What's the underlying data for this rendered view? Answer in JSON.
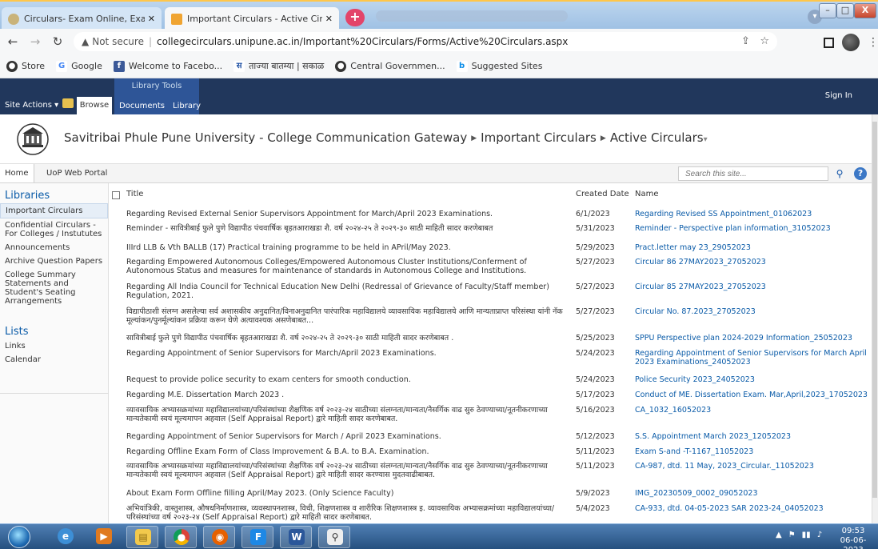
{
  "browser": {
    "tabs": [
      {
        "title": "Circulars- Exam Online, Examinat",
        "active": false
      },
      {
        "title": "Important Circulars - Active Circu",
        "active": true
      }
    ],
    "new_tab": "+",
    "window_controls": {
      "minimize": "–",
      "maximize": "□",
      "close": "X"
    },
    "url_warning": "Not secure",
    "url": "collegecirculars.unipune.ac.in/Important%20Circulars/Forms/Active%20Circulars.aspx",
    "bookmarks": [
      {
        "label": "Store",
        "icon": "chrome-web-store-icon"
      },
      {
        "label": "Google",
        "icon": "google-icon"
      },
      {
        "label": "Welcome to Facebo...",
        "icon": "facebook-icon"
      },
      {
        "label": "ताज्या बातम्या | सकाळ",
        "icon": "sakal-icon"
      },
      {
        "label": "Central Governmen...",
        "icon": "globe-icon"
      },
      {
        "label": "Suggested Sites",
        "icon": "bing-icon"
      }
    ]
  },
  "ribbon": {
    "site_actions": "Site Actions ▾",
    "browse": "Browse",
    "context_label": "Library Tools",
    "context_tabs": [
      "Documents",
      "Library"
    ],
    "sign_in": "Sign In"
  },
  "header": {
    "site_name": "Savitribai Phule Pune University - College Communication Gateway",
    "crumb_1": "Important Circulars",
    "crumb_2": "Active Circulars",
    "crumb_2_suffix": "▾"
  },
  "toplinks": {
    "home": "Home",
    "portal": "UoP Web Portal",
    "search_placeholder": "Search this site..."
  },
  "leftnav": {
    "libraries_heading": "Libraries",
    "libraries": [
      "Important Circulars",
      "Confidential Circulars - For Colleges / Instututes",
      "Announcements",
      "Archive Question Papers",
      "College Summary Statements and Student's Seating Arrangements"
    ],
    "lists_heading": "Lists",
    "lists": [
      "Links",
      "Calendar"
    ]
  },
  "list": {
    "columns": {
      "title": "Title",
      "created": "Created Date",
      "name": "Name"
    },
    "rows": [
      {
        "title": "Regarding Revised External Senior Supervisors Appointment for March/April 2023 Examinations.",
        "created": "6/1/2023",
        "name": "Regarding Revised SS Appointment_01062023"
      },
      {
        "title": "Reminder - सावित्रीबाई फुले पुणे विद्यापीठ पंचवार्षिक बृहतआराखडा शै. वर्ष २०२४-२५ ते २०२९-३० साठी माहिती सादर करणेबाबत",
        "created": "5/31/2023",
        "name": "Reminder - Perspective plan information_31052023"
      },
      {
        "title": "IIIrd LLB & Vth BALLB (17) Practical training programme to be held in APril/May 2023.",
        "created": "5/29/2023",
        "name": "Pract.letter may 23_29052023"
      },
      {
        "title": " Regarding Empowered Autonomous Colleges/Empowered Autonomous Cluster Institutions/Conferment of Autonomous Status and measures for maintenance of standards in Autonomous College and Institutions.",
        "created": "5/27/2023",
        "name": "Circular 86 27MAY2023_27052023"
      },
      {
        "title": "Regarding All India Council for Technical Education New Delhi (Redressal of Grievance of Faculty/Staff member) Regulation, 2021.",
        "created": "5/27/2023",
        "name": "Circular 85 27MAY2023_27052023"
      },
      {
        "title": "विद्यापीठाशी संलग्न असलेल्या सर्व अशासकीय अनुदानित/विनाअनुदानित पारंपारिक महाविद्यालये व्यावसायिक महाविद्यालये आणि मान्यताप्राप्त परिसंस्था यांनी नॅक मूल्यांकन/पुनर्मूल्यांकन प्रक्रिया करून घेणे अत्यावश्यक असणेबाबत...",
        "created": "5/27/2023",
        "name": "Circular No. 87.2023_27052023"
      },
      {
        "title": "सावित्रीबाई फुले पुणे विद्यापीठ पंचवार्षिक बृहतआराखडा शै. वर्ष २०२४-२५ ते २०२९-३० साठी माहिती सादर करणेबाबत .",
        "created": "5/25/2023",
        "name": "SPPU Perspective plan 2024-2029 Information_25052023"
      },
      {
        "title": "Regarding  Appointment of Senior Supervisors for March/April 2023  Examinations.",
        "created": "5/24/2023",
        "name": "Regarding Appointment of Senior Supervisors for March April 2023 Examinations_24052023"
      },
      {
        "title": "Request to provide police security to exam centers for smooth conduction.",
        "created": "5/24/2023",
        "name": "Police Security 2023_24052023"
      },
      {
        "title": "Regarding M.E. Dissertation March 2023 .",
        "created": "5/17/2023",
        "name": "Conduct of ME. Dissertation Exam. Mar,April,2023_17052023"
      },
      {
        "title": "व्यावसायिक अभ्यासक्रमांच्या महाविद्यालयांच्या/परिसंस्थांच्या शैक्षणिक वर्ष २०२३-२४ साठीच्या संलग्नता/मान्यता/नैसर्गिक वाढ सुरु ठेवण्याच्या/नूतनीकरणाच्या मान्यतेकामी स्वयं मूल्यमापन अहवाल (Self Appraisal Report) द्वारे माहिती सादर करणेबाबत.",
        "created": "5/16/2023",
        "name": "CA_1032_16052023"
      },
      {
        "title": "Regarding  Appointment of Senior Supervisors for March / April 2023  Examinations.",
        "created": "5/12/2023",
        "name": "S.S. Appointment March 2023_12052023"
      },
      {
        "title": "Regarding Offline Exam Form of Class Improvement & B.A. to B.A. Examination.",
        "created": "5/11/2023",
        "name": "Exam S-and -T-1167_11052023"
      },
      {
        "title": "व्यावसायिक अभ्यासक्रमांच्या महाविद्यालयांच्या/परिसंस्थांच्या शैक्षणिक वर्ष २०२३-२४ साठीच्या संलग्नता/मान्यता/नैसर्गिक वाढ सुरु ठेवण्याच्या/नूतनीकरणाच्या मान्यतेकामी स्वयं मूल्यमापन अहवाल (Self Appraisal Report) द्वारे माहिती सादर करण्यास मुदतवाढीबाबत.",
        "created": "5/11/2023",
        "name": "CA-987, dtd. 11 May, 2023_Circular._11052023"
      },
      {
        "title": "About Exam Form Offline filling April/May 2023. (Only Science Faculty)",
        "created": "5/9/2023",
        "name": "IMG_20230509_0002_09052023"
      },
      {
        "title": "अभियांत्रिकी, वास्तुशास्त्र, औषधनिर्माणशास्त्र, व्यवस्थापनशास्त्र, विधी, शिक्षणशास्त्र व शारीरिक शिक्षणशास्त्र इ. व्यावसायिक अभ्यासक्रमांच्या महाविद्यालयांच्या/परिसंस्थांच्या वर्ष २०२३-२४ (Self Appraisal Report) द्वारे माहिती सादर करणेबाबत.",
        "created": "5/4/2023",
        "name": "CA-933, dtd. 04-05-2023 SAR 2023-24_04052023"
      }
    ]
  },
  "taskbar": {
    "time": "09:53",
    "date": "06-06-2023"
  }
}
